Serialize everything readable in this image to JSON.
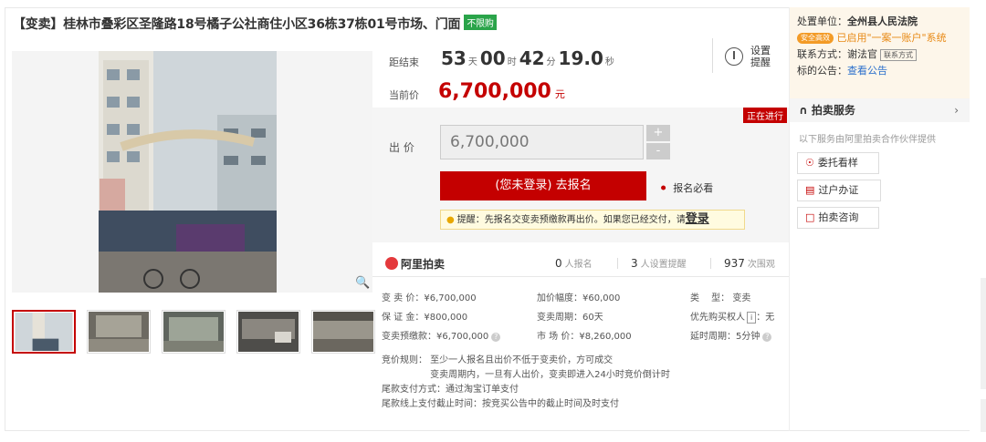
{
  "title": {
    "text": "【变卖】桂林市叠彩区圣隆路18号橘子公社商住小区36栋37栋01号市场、门面",
    "tag": "不限购"
  },
  "countdown": {
    "label": "距结束",
    "days": "53",
    "days_unit": "天",
    "hours": "00",
    "hours_unit": "时",
    "minutes": "42",
    "minutes_unit": "分",
    "seconds": "19.0",
    "seconds_unit": "秒"
  },
  "remind": {
    "label": "设置提醒"
  },
  "current_price": {
    "label": "当前价",
    "value": "6,700,000",
    "unit": "元"
  },
  "bid": {
    "status": "正在进行",
    "label": "出 价",
    "input_value": "6,700,000",
    "plus": "+",
    "minus": "-",
    "register_button": "(您未登录) 去报名",
    "must_read": "报名必看",
    "tip_text": "提醒：先报名交变卖预缴款再出价。如果您已经交付，请",
    "tip_link": "登录"
  },
  "stats": {
    "brand": "阿里拍卖",
    "signups": "0",
    "signups_label": "人报名",
    "reminders": "3",
    "reminders_label": "人设置提醒",
    "views": "937",
    "views_label": "次围观"
  },
  "details": {
    "sale_price": "变 卖 价：¥6,700,000",
    "increment": "加价幅度：¥60,000",
    "type": "类　 型：  变卖",
    "deposit": "保 证 金：¥800,000",
    "period": "变卖周期：60天",
    "priority": "优先购买权人",
    "priority_value": "：无",
    "prepay": "变卖预缴款：¥6,700,000",
    "market_price": "市 场 价：¥8,260,000",
    "delay": "延时周期：5分钟"
  },
  "rules": [
    "竞价规则：  至少一人报名且出价不低于变卖价，方可成交",
    "　　　　　 变卖周期内，一旦有人出价，变卖即进入24小时竞价倒计时",
    "尾款支付方式：通过淘宝订单支付",
    "尾款线上支付截止时间：按竞买公告中的截止时间及时支付"
  ],
  "sidebar": {
    "court_label": "处置单位：",
    "court_name": "全州县人民法院",
    "safe_badge": "安全高效",
    "safe_text": "已启用\"一案一账户\"系统",
    "contact_label": "联系方式：谢法官",
    "contact_tag": "联系方式",
    "notice_label": "标的公告：",
    "notice_link": "查看公告",
    "service_title": "拍卖服务",
    "service_sub": "以下服务由阿里拍卖合作伙伴提供",
    "services": [
      "委托看样",
      "过户办证",
      "拍卖咨询"
    ]
  }
}
